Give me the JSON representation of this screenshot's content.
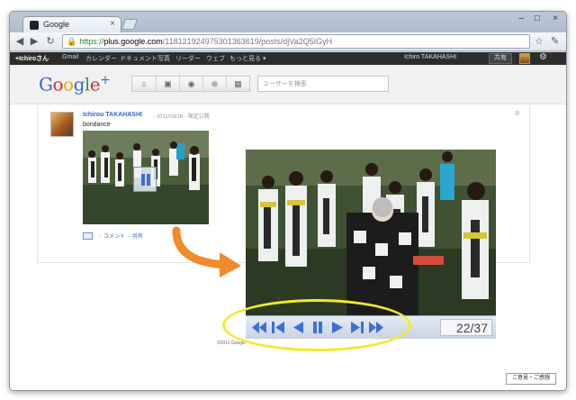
{
  "browser": {
    "tab_title": "Google",
    "tab_close": "×",
    "url_lock": "🔒",
    "url_scheme": "https://",
    "url_host": "plus.google.com",
    "url_path": "/118121924975301363619/posts/djVa2Q5IGyH",
    "window_controls": [
      "–",
      "□",
      "×"
    ],
    "icons": {
      "back": "back-arrow-icon",
      "forward": "forward-arrow-icon",
      "reload": "reload-icon",
      "star": "star-icon",
      "wrench": "wrench-icon"
    }
  },
  "gbar": {
    "items": [
      "+Ichiroさん",
      "Gmail",
      "カレンダー",
      "ドキュメント",
      "写真",
      "リーダー",
      "ウェブ",
      "もっと見る ▾"
    ],
    "user_name": "Ichiro TAKAHASHI",
    "share_label": "共有",
    "gear": "⚙"
  },
  "gplus": {
    "logo_parts": [
      "G",
      "o",
      "o",
      "g",
      "l",
      "e"
    ],
    "logo_plus": "+",
    "nav_icons": [
      "home-icon",
      "photos-icon",
      "profile-icon",
      "circles-icon",
      "games-icon"
    ],
    "nav_glyphs": [
      "⌂",
      "▣",
      "◉",
      "⊛",
      "▦"
    ],
    "search_placeholder": "ユーザーを検索"
  },
  "post": {
    "author": "Ichirou TAKAHASHI",
    "meta": " - 2011/08/16 - 限定公開",
    "text": "bondance",
    "actions": [
      "コメント",
      "共有"
    ],
    "action_sep": "-",
    "close": "⊗",
    "copyright": "©2011 Google"
  },
  "viewer": {
    "counter": "22/37",
    "controls": [
      "first-icon",
      "skip-back-icon",
      "prev-icon",
      "pause-icon",
      "play-icon",
      "skip-forward-icon",
      "last-icon"
    ]
  },
  "statusbar": {
    "button_label": "ご意見・ご感想"
  },
  "colors": {
    "highlight": "#f2ea2b",
    "arrow": "#f08a2a",
    "control_blue": "#3e6fd3"
  }
}
